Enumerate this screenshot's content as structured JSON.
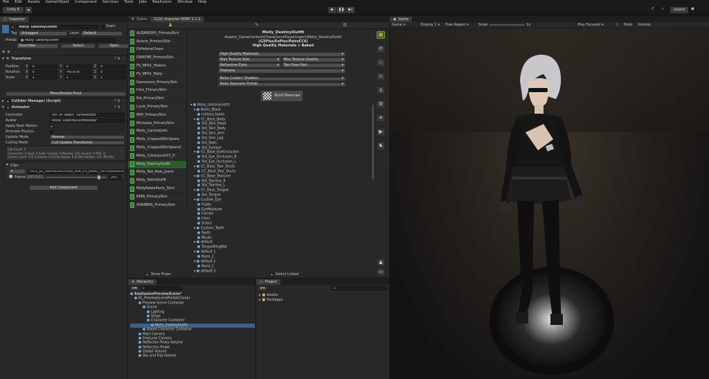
{
  "menu": [
    "File",
    "Edit",
    "Assets",
    "GameObject",
    "Component",
    "Services",
    "Tools",
    "Jobs",
    "Reallusion",
    "Window",
    "Help"
  ],
  "toolbar": {
    "project": "Unity 6",
    "layout": "Layout"
  },
  "inspector": {
    "tab": "Inspector",
    "object_name": "Molly_DestinyOutfit",
    "static_label": "Static",
    "tag_label": "Tag",
    "tag_value": "Untagged",
    "layer_label": "Layer",
    "layer_value": "Default",
    "prefab_label": "Prefab",
    "prefab_value": "Molly_DestinyOutfit",
    "overrides": "Overrides",
    "select": "Select",
    "open": "Open",
    "transform": {
      "title": "Transform",
      "position_label": "Position",
      "rotation_label": "Rotation",
      "scale_label": "Scale",
      "position": {
        "x": "0",
        "y": "0",
        "z": "0"
      },
      "rotation": {
        "x": "0",
        "y": "-45.878",
        "z": "0"
      },
      "scale": {
        "x": "1",
        "y": "1",
        "z": "1"
      },
      "pivot_button": "Move/Rotate Pivot"
    },
    "collider_title": "Collider Manager (Script)",
    "animator": {
      "title": "Animator",
      "controller_label": "Controller",
      "controller_value": "ctrl_of_React_TurnAround",
      "avatar_label": "Avatar",
      "avatar_value": "Molly_DestinyOutfitAvatar",
      "apply_root_label": "Apply Root Motion",
      "physics_label": "Animate Physics",
      "update_label": "Update Mode",
      "update_value": "Normal",
      "culling_label": "Culling Mode",
      "culling_value": "Cull Update Transforms",
      "info_lines": [
        "Clip Count: 1",
        "Curves Pos: 0 Quat: 0 Euler: 0 Scale: 0 Muscles: 151 Generic: 0 PPtr: 0",
        "Curves Count: 151 Constant: 0 (4.6%) Dense: 0 (0.0%) Stream: 151 (95.4%)"
      ]
    },
    "clips": {
      "title": "Clips",
      "clip_value": "MCU_pf_StandCustomize_Idle_21_React_TurnLookBehind",
      "frame_label": "Frame (207/231)",
      "frame_value": "207",
      "frame_progress": 0.896
    },
    "add_component": "Add Component"
  },
  "scene_tabs": {
    "scene": "Scene",
    "importer": "CC/iC Importer HDRP 2.1.3"
  },
  "character_list": [
    "ALEJANDRO_PrimarySkin",
    "Aurora_PrimarySkin",
    "DrHelenaChase",
    "DWAYNE_PrimarySkin",
    "FS_MP01_Helena",
    "FS_MP01_Molly",
    "Genevieve_PrimarySkin",
    "Irina_PrimarySkin",
    "Kia_PrimarySkin",
    "Lucia_PrimarySkin",
    "MAY_PrimarySkin",
    "Michaela_PrimarySkin",
    "Molly_CamilaGoth",
    "Molly_CroppedShirtJeans",
    "Molly_CroppedShirtJeansC",
    "Molly_CyberpunkV3_D",
    "Molly_DestinyOutfit",
    "Molly_Not_New_Jeans",
    "Molly_RetroOutfit",
    "MollyNoblePants_Shirt",
    "REMI_PrimarySkin",
    "SHANEKA_PrimarySkin"
  ],
  "selected_character": "Molly_DestinyOutfit",
  "importer": {
    "name": "Molly_DestinyOutfit",
    "path": "Assets\\_GameContent\\Characters\\PlayerUrgent\\Molly_DestinyOutfit",
    "gen": "(G3Plus/ExPlus/PairsCC4)",
    "quality": "High Quality Materials + Baked",
    "hq_materials": "High Quality Materials",
    "max_tex_size": "Max Texture Size",
    "max_tex_quality": "Max Texture Quality",
    "refractive_eyes": "Refractive Eyes",
    "two_pass_hair": "Two Pass Hair",
    "features": "Features",
    "bake_shaders": "Bake Custom Shaders",
    "bake_prefab": "Bake Separate Prefab",
    "build_button": "Build Materials",
    "show_props": "Show Props",
    "select_linked": "Select Linked"
  },
  "bone_tree": [
    "Molly_DestinyOutfit",
    "Boots_Black",
    "military boots",
    "CC_Base_Body",
    "Std_Skin_Head",
    "Std_Skin_Body",
    "Std_Skin_Arm",
    "Std_Skin_Leg",
    "Std_Nails",
    "Std_Eyelash",
    "CC_Base_EyeOcclusion",
    "Std_Eye_Occlusion_R",
    "Std_Eye_Occlusion_L",
    "CC_Base_Tear_Ducts",
    "CC_Base_Tear_Ducts",
    "CC_Base_TearLine",
    "Std_Tearline_R",
    "Std_Tearline_L",
    "CC_Base_Tongue",
    "Std_Tongue",
    "Custom_Eye",
    "Pupils",
    "EyeMoisture",
    "Cornea",
    "Irises",
    "Sclera",
    "Custom_Teeth",
    "Teeth",
    "Mouth",
    "default",
    "TongueRingMat",
    "default 1",
    "None_2",
    "default 2",
    "None_1",
    "default 3",
    "None_0",
    "default 4"
  ],
  "hierarchy": {
    "tab": "Hierarchy",
    "items": [
      "ReallusionPreviewScene*",
      "RL_PreviewScenePrefab(Clone)",
      "Preview Scene Container",
      "Scene",
      "Lighting",
      "Stage",
      "Character Container",
      "Molly_DestinyOutfit",
      "Baked Character Container",
      "Main Camera",
      "FreeLook Camera",
      "Reflection Proxy Volume",
      "Reflection Probe",
      "Global Volume",
      "Sky and Fog Volume"
    ]
  },
  "project": {
    "tab": "Project",
    "items": [
      "Assets",
      "Packages"
    ]
  },
  "game": {
    "tab": "Game",
    "mode": "Game",
    "display": "Display 1",
    "aspect": "Free Aspect",
    "scale_label": "Scale",
    "scale_value": "1x",
    "play_focused": "Play Focused",
    "stats": "Stats",
    "gizmos": "Gizmos"
  },
  "colors": {
    "accent": "#2c5a2a",
    "green_icon": "#7ac843",
    "highlight": "#3d5f8a"
  }
}
